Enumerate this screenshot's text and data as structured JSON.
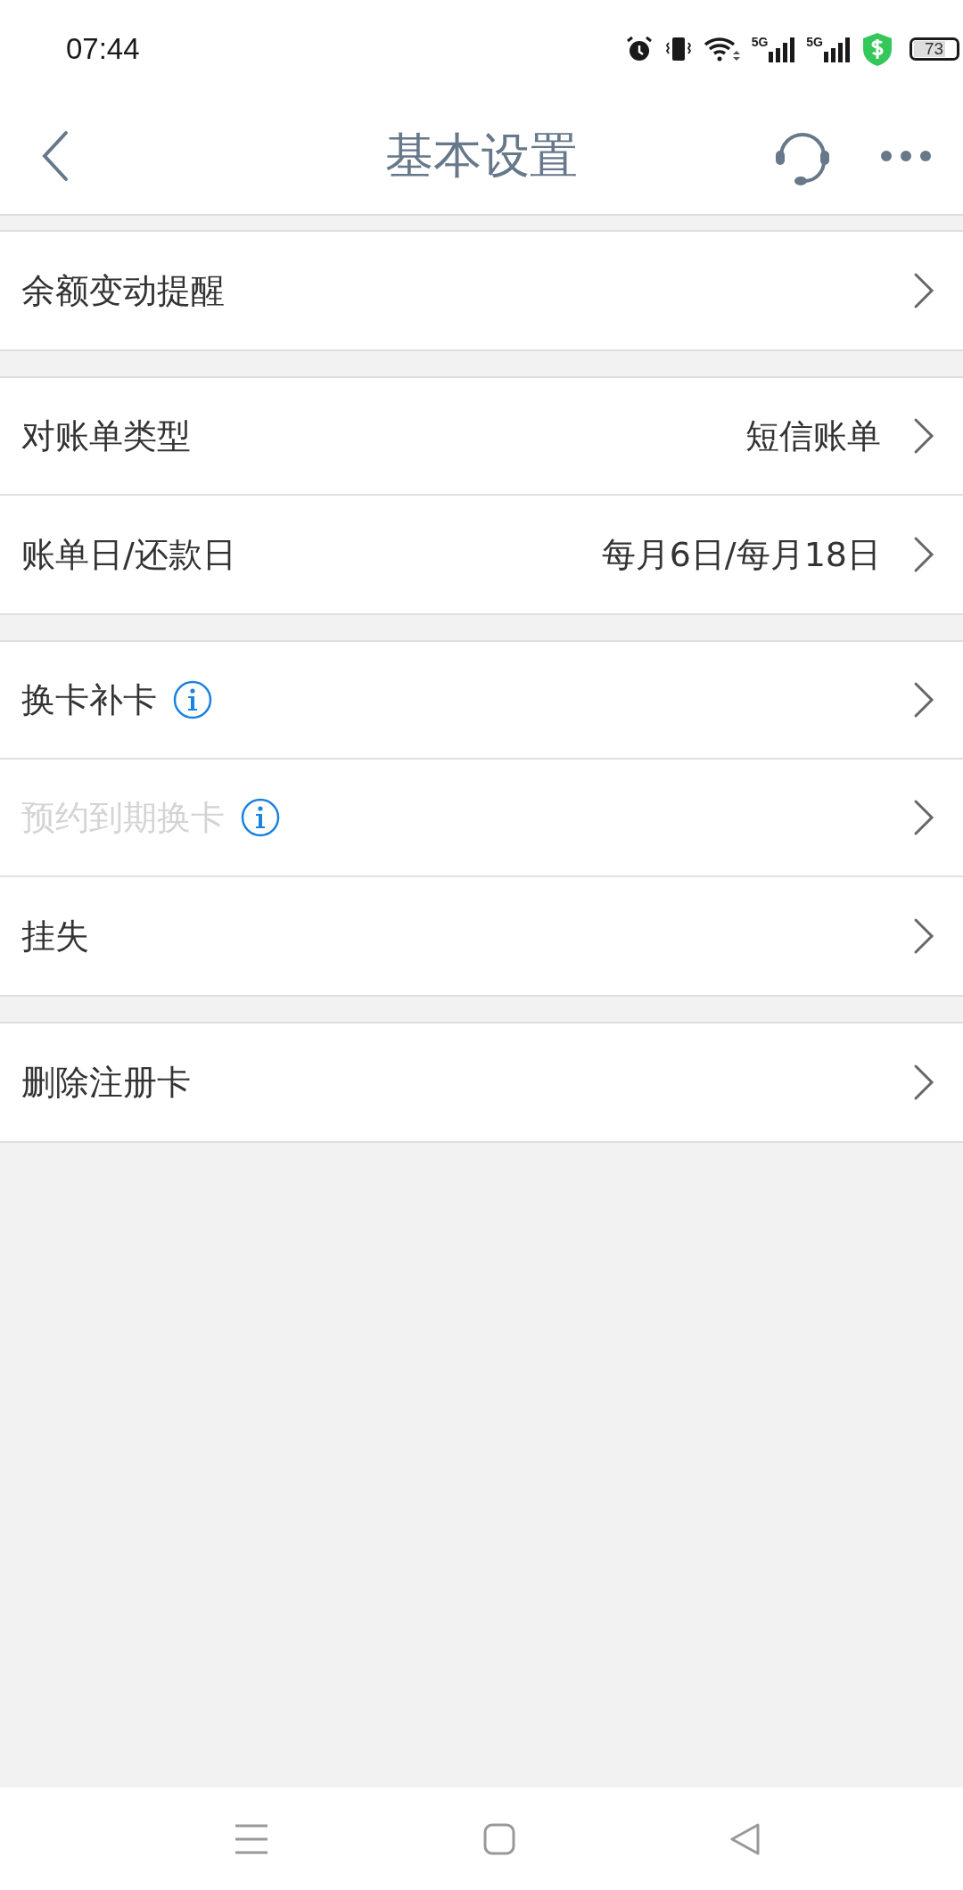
{
  "status_bar": {
    "time": "07:44",
    "battery": "73",
    "networks": [
      {
        "label": "5G"
      },
      {
        "label": "5G"
      }
    ]
  },
  "header": {
    "title": "基本设置"
  },
  "sections": [
    {
      "items": [
        {
          "label": "余额变动提醒",
          "info": false,
          "disabled": false
        }
      ]
    },
    {
      "items": [
        {
          "label": "对账单类型",
          "value": "短信账单",
          "info": false,
          "disabled": false
        },
        {
          "label": "账单日/还款日",
          "value": "每月6日/每月18日",
          "info": false,
          "disabled": false
        }
      ]
    },
    {
      "items": [
        {
          "label": "换卡补卡",
          "info": true,
          "disabled": false
        },
        {
          "label": "预约到期换卡",
          "info": true,
          "disabled": true
        },
        {
          "label": "挂失",
          "info": false,
          "disabled": false
        }
      ]
    },
    {
      "items": [
        {
          "label": "删除注册卡",
          "info": false,
          "disabled": false
        }
      ]
    }
  ]
}
